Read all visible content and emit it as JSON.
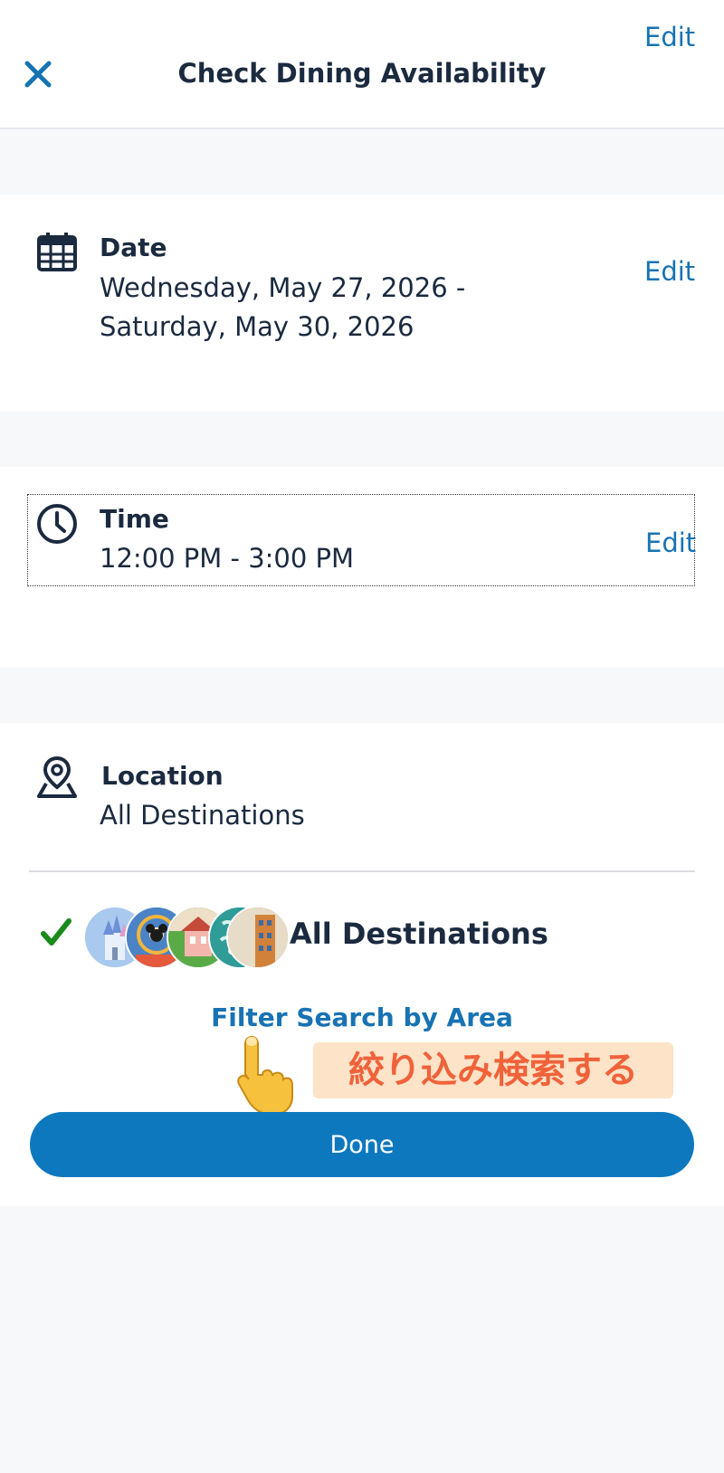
{
  "header": {
    "title": "Check Dining Availability",
    "edit_label": "Edit",
    "close_icon": "close-icon"
  },
  "date": {
    "label": "Date",
    "value_line1": "Wednesday, May 27, 2026 -",
    "value_line2": "Saturday, May 30, 2026",
    "edit_label": "Edit",
    "icon": "calendar-icon"
  },
  "time": {
    "label": "Time",
    "value": "12:00 PM - 3:00 PM",
    "edit_label": "Edit",
    "icon": "clock-icon"
  },
  "location": {
    "label": "Location",
    "value": "All Destinations",
    "icon": "location-map-icon"
  },
  "destination_option": {
    "label": "All Destinations",
    "selected": true,
    "icons": [
      "magic-kingdom-icon",
      "epcot-icon",
      "hollywood-studios-icon",
      "animal-kingdom-icon",
      "disney-springs-icon"
    ]
  },
  "filter_link": "Filter Search by Area",
  "annotation_text": "絞り込み検索する",
  "done_label": "Done",
  "colors": {
    "accent": "#1773b3",
    "button": "#0e78bf",
    "text": "#1b2a3f",
    "check": "#1a8a1a",
    "annotation_bg": "#fde3c8",
    "annotation_text": "#f0623a",
    "background": "#f6f8fa"
  }
}
